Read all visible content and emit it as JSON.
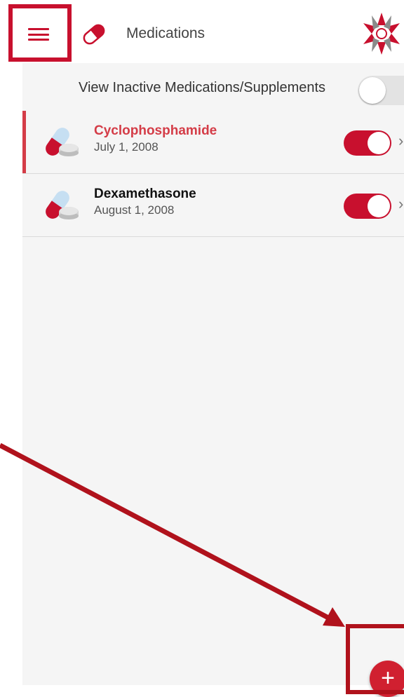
{
  "header": {
    "title": "Medications",
    "menu_icon": "hamburger-menu-icon",
    "section_icon": "pill-icon",
    "logo": "flower-logo"
  },
  "inactive_toggle": {
    "label": "View Inactive Medications/Supplements",
    "state": "off"
  },
  "medications": [
    {
      "name": "Cyclophosphamide",
      "date": "July 1, 2008",
      "active": true,
      "selected": true,
      "icon": "pills-icon"
    },
    {
      "name": "Dexamethasone",
      "date": "August 1, 2008",
      "active": true,
      "selected": false,
      "icon": "pills-icon"
    }
  ],
  "fab": {
    "label": "+",
    "icon": "add-icon"
  },
  "colors": {
    "accent": "#c8102e",
    "selected_text": "#d43c47",
    "background": "#f5f5f5",
    "annotation": "#b0121c"
  }
}
